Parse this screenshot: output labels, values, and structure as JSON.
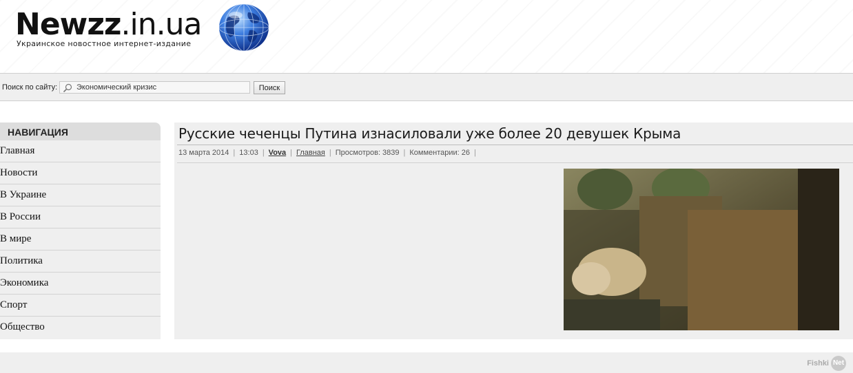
{
  "header": {
    "logo_bold": "Newzz",
    "logo_rest": ".in.ua",
    "tagline": "Украинское новостное интернет-издание"
  },
  "search": {
    "label": "Поиск по сайту:",
    "value": "Экономический кризис",
    "button": "Поиск"
  },
  "sidebar": {
    "title": "НАВИГАЦИЯ",
    "items": [
      {
        "label": "Главная"
      },
      {
        "label": "Новости"
      },
      {
        "label": "В Украине"
      },
      {
        "label": "В России"
      },
      {
        "label": "В мире"
      },
      {
        "label": "Политика"
      },
      {
        "label": "Экономика"
      },
      {
        "label": "Спорт"
      },
      {
        "label": "Общество"
      }
    ]
  },
  "article": {
    "title": "Русские чеченцы Путина изнасиловали уже более 20 девушек Крыма",
    "date": "13 марта 2014",
    "time": "13:03",
    "author": "Vova",
    "category": "Главная",
    "views": "Просмотров: 3839",
    "comments": "Комментарии: 26"
  },
  "footer": {
    "watermark_fishki": "Fishki",
    "watermark_net": "Net"
  },
  "colors": {
    "panel_bg": "#efefef",
    "nav_header_bg": "#dddddd",
    "globe_blue": "#2a5fc8"
  }
}
